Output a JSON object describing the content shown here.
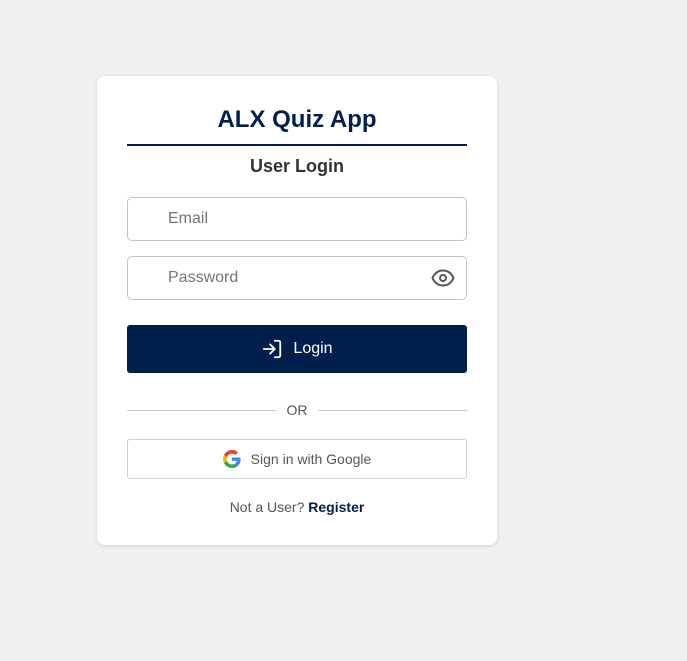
{
  "header": {
    "app_title": "ALX Quiz App",
    "subtitle": "User Login"
  },
  "form": {
    "email_placeholder": "Email",
    "email_value": "",
    "password_placeholder": "Password",
    "password_value": "",
    "login_label": "Login",
    "divider_text": "OR",
    "google_label": "Sign in with Google"
  },
  "footer": {
    "prompt": "Not a User?",
    "register_label": "Register"
  },
  "icons": {
    "password_toggle": "eye-icon",
    "login": "login-arrow-icon",
    "google": "google-logo-icon"
  },
  "colors": {
    "background": "#f0f0f0",
    "card": "#ffffff",
    "primary": "#001f4d",
    "subtitle": "#333333",
    "muted_text": "#555555"
  }
}
